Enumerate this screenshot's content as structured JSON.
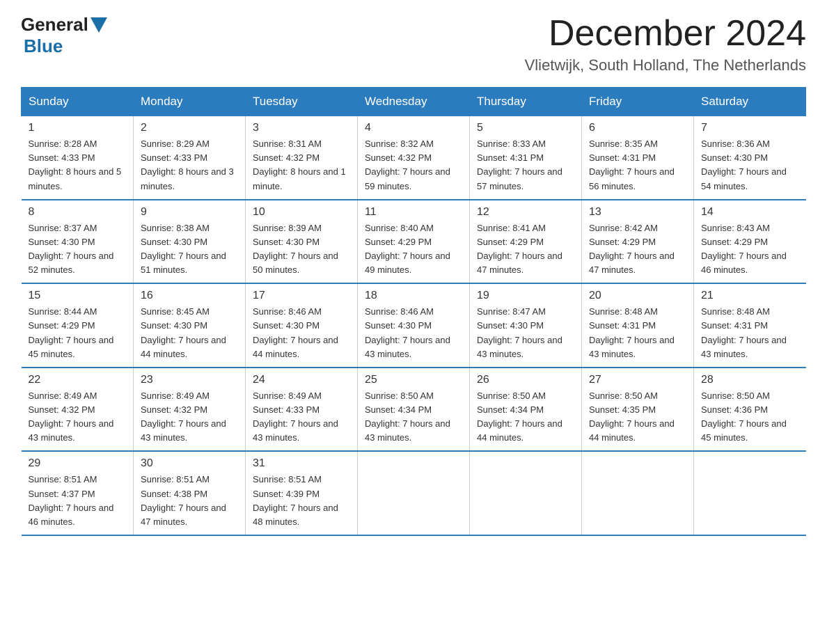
{
  "header": {
    "logo_text_general": "General",
    "logo_text_blue": "Blue",
    "month_title": "December 2024",
    "location": "Vlietwijk, South Holland, The Netherlands"
  },
  "weekdays": [
    "Sunday",
    "Monday",
    "Tuesday",
    "Wednesday",
    "Thursday",
    "Friday",
    "Saturday"
  ],
  "weeks": [
    [
      {
        "day": "1",
        "sunrise": "8:28 AM",
        "sunset": "4:33 PM",
        "daylight": "8 hours and 5 minutes."
      },
      {
        "day": "2",
        "sunrise": "8:29 AM",
        "sunset": "4:33 PM",
        "daylight": "8 hours and 3 minutes."
      },
      {
        "day": "3",
        "sunrise": "8:31 AM",
        "sunset": "4:32 PM",
        "daylight": "8 hours and 1 minute."
      },
      {
        "day": "4",
        "sunrise": "8:32 AM",
        "sunset": "4:32 PM",
        "daylight": "7 hours and 59 minutes."
      },
      {
        "day": "5",
        "sunrise": "8:33 AM",
        "sunset": "4:31 PM",
        "daylight": "7 hours and 57 minutes."
      },
      {
        "day": "6",
        "sunrise": "8:35 AM",
        "sunset": "4:31 PM",
        "daylight": "7 hours and 56 minutes."
      },
      {
        "day": "7",
        "sunrise": "8:36 AM",
        "sunset": "4:30 PM",
        "daylight": "7 hours and 54 minutes."
      }
    ],
    [
      {
        "day": "8",
        "sunrise": "8:37 AM",
        "sunset": "4:30 PM",
        "daylight": "7 hours and 52 minutes."
      },
      {
        "day": "9",
        "sunrise": "8:38 AM",
        "sunset": "4:30 PM",
        "daylight": "7 hours and 51 minutes."
      },
      {
        "day": "10",
        "sunrise": "8:39 AM",
        "sunset": "4:30 PM",
        "daylight": "7 hours and 50 minutes."
      },
      {
        "day": "11",
        "sunrise": "8:40 AM",
        "sunset": "4:29 PM",
        "daylight": "7 hours and 49 minutes."
      },
      {
        "day": "12",
        "sunrise": "8:41 AM",
        "sunset": "4:29 PM",
        "daylight": "7 hours and 47 minutes."
      },
      {
        "day": "13",
        "sunrise": "8:42 AM",
        "sunset": "4:29 PM",
        "daylight": "7 hours and 47 minutes."
      },
      {
        "day": "14",
        "sunrise": "8:43 AM",
        "sunset": "4:29 PM",
        "daylight": "7 hours and 46 minutes."
      }
    ],
    [
      {
        "day": "15",
        "sunrise": "8:44 AM",
        "sunset": "4:29 PM",
        "daylight": "7 hours and 45 minutes."
      },
      {
        "day": "16",
        "sunrise": "8:45 AM",
        "sunset": "4:30 PM",
        "daylight": "7 hours and 44 minutes."
      },
      {
        "day": "17",
        "sunrise": "8:46 AM",
        "sunset": "4:30 PM",
        "daylight": "7 hours and 44 minutes."
      },
      {
        "day": "18",
        "sunrise": "8:46 AM",
        "sunset": "4:30 PM",
        "daylight": "7 hours and 43 minutes."
      },
      {
        "day": "19",
        "sunrise": "8:47 AM",
        "sunset": "4:30 PM",
        "daylight": "7 hours and 43 minutes."
      },
      {
        "day": "20",
        "sunrise": "8:48 AM",
        "sunset": "4:31 PM",
        "daylight": "7 hours and 43 minutes."
      },
      {
        "day": "21",
        "sunrise": "8:48 AM",
        "sunset": "4:31 PM",
        "daylight": "7 hours and 43 minutes."
      }
    ],
    [
      {
        "day": "22",
        "sunrise": "8:49 AM",
        "sunset": "4:32 PM",
        "daylight": "7 hours and 43 minutes."
      },
      {
        "day": "23",
        "sunrise": "8:49 AM",
        "sunset": "4:32 PM",
        "daylight": "7 hours and 43 minutes."
      },
      {
        "day": "24",
        "sunrise": "8:49 AM",
        "sunset": "4:33 PM",
        "daylight": "7 hours and 43 minutes."
      },
      {
        "day": "25",
        "sunrise": "8:50 AM",
        "sunset": "4:34 PM",
        "daylight": "7 hours and 43 minutes."
      },
      {
        "day": "26",
        "sunrise": "8:50 AM",
        "sunset": "4:34 PM",
        "daylight": "7 hours and 44 minutes."
      },
      {
        "day": "27",
        "sunrise": "8:50 AM",
        "sunset": "4:35 PM",
        "daylight": "7 hours and 44 minutes."
      },
      {
        "day": "28",
        "sunrise": "8:50 AM",
        "sunset": "4:36 PM",
        "daylight": "7 hours and 45 minutes."
      }
    ],
    [
      {
        "day": "29",
        "sunrise": "8:51 AM",
        "sunset": "4:37 PM",
        "daylight": "7 hours and 46 minutes."
      },
      {
        "day": "30",
        "sunrise": "8:51 AM",
        "sunset": "4:38 PM",
        "daylight": "7 hours and 47 minutes."
      },
      {
        "day": "31",
        "sunrise": "8:51 AM",
        "sunset": "4:39 PM",
        "daylight": "7 hours and 48 minutes."
      },
      null,
      null,
      null,
      null
    ]
  ]
}
